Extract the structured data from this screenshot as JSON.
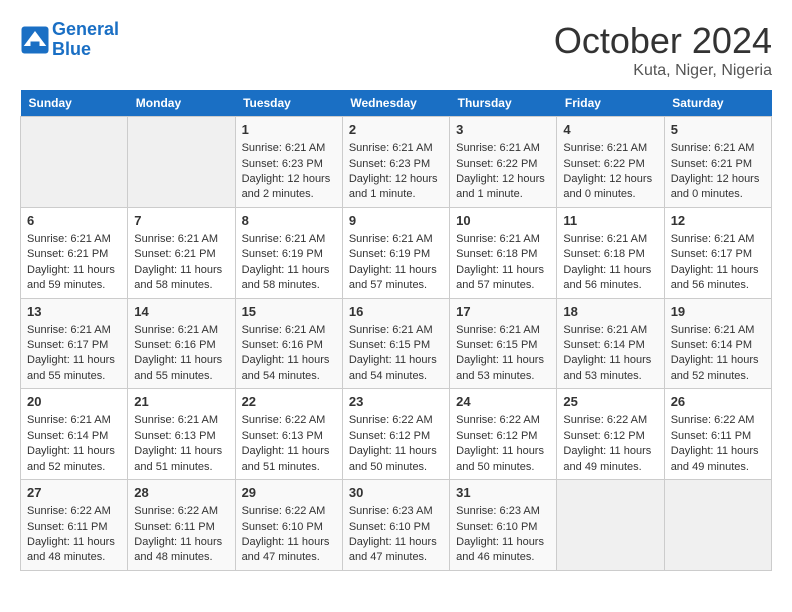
{
  "header": {
    "logo_line1": "General",
    "logo_line2": "Blue",
    "main_title": "October 2024",
    "subtitle": "Kuta, Niger, Nigeria"
  },
  "calendar": {
    "days_of_week": [
      "Sunday",
      "Monday",
      "Tuesday",
      "Wednesday",
      "Thursday",
      "Friday",
      "Saturday"
    ],
    "weeks": [
      [
        {
          "day": "",
          "empty": true
        },
        {
          "day": "",
          "empty": true
        },
        {
          "day": "1",
          "sunrise": "6:21 AM",
          "sunset": "6:23 PM",
          "daylight": "Daylight: 12 hours and 2 minutes."
        },
        {
          "day": "2",
          "sunrise": "6:21 AM",
          "sunset": "6:23 PM",
          "daylight": "Daylight: 12 hours and 1 minute."
        },
        {
          "day": "3",
          "sunrise": "6:21 AM",
          "sunset": "6:22 PM",
          "daylight": "Daylight: 12 hours and 1 minute."
        },
        {
          "day": "4",
          "sunrise": "6:21 AM",
          "sunset": "6:22 PM",
          "daylight": "Daylight: 12 hours and 0 minutes."
        },
        {
          "day": "5",
          "sunrise": "6:21 AM",
          "sunset": "6:21 PM",
          "daylight": "Daylight: 12 hours and 0 minutes."
        }
      ],
      [
        {
          "day": "6",
          "sunrise": "6:21 AM",
          "sunset": "6:21 PM",
          "daylight": "Daylight: 11 hours and 59 minutes."
        },
        {
          "day": "7",
          "sunrise": "6:21 AM",
          "sunset": "6:21 PM",
          "daylight": "Daylight: 11 hours and 58 minutes."
        },
        {
          "day": "8",
          "sunrise": "6:21 AM",
          "sunset": "6:19 PM",
          "daylight": "Daylight: 11 hours and 58 minutes."
        },
        {
          "day": "9",
          "sunrise": "6:21 AM",
          "sunset": "6:19 PM",
          "daylight": "Daylight: 11 hours and 57 minutes."
        },
        {
          "day": "10",
          "sunrise": "6:21 AM",
          "sunset": "6:18 PM",
          "daylight": "Daylight: 11 hours and 57 minutes."
        },
        {
          "day": "11",
          "sunrise": "6:21 AM",
          "sunset": "6:18 PM",
          "daylight": "Daylight: 11 hours and 56 minutes."
        },
        {
          "day": "12",
          "sunrise": "6:21 AM",
          "sunset": "6:17 PM",
          "daylight": "Daylight: 11 hours and 56 minutes."
        }
      ],
      [
        {
          "day": "13",
          "sunrise": "6:21 AM",
          "sunset": "6:17 PM",
          "daylight": "Daylight: 11 hours and 55 minutes."
        },
        {
          "day": "14",
          "sunrise": "6:21 AM",
          "sunset": "6:16 PM",
          "daylight": "Daylight: 11 hours and 55 minutes."
        },
        {
          "day": "15",
          "sunrise": "6:21 AM",
          "sunset": "6:16 PM",
          "daylight": "Daylight: 11 hours and 54 minutes."
        },
        {
          "day": "16",
          "sunrise": "6:21 AM",
          "sunset": "6:15 PM",
          "daylight": "Daylight: 11 hours and 54 minutes."
        },
        {
          "day": "17",
          "sunrise": "6:21 AM",
          "sunset": "6:15 PM",
          "daylight": "Daylight: 11 hours and 53 minutes."
        },
        {
          "day": "18",
          "sunrise": "6:21 AM",
          "sunset": "6:14 PM",
          "daylight": "Daylight: 11 hours and 53 minutes."
        },
        {
          "day": "19",
          "sunrise": "6:21 AM",
          "sunset": "6:14 PM",
          "daylight": "Daylight: 11 hours and 52 minutes."
        }
      ],
      [
        {
          "day": "20",
          "sunrise": "6:21 AM",
          "sunset": "6:14 PM",
          "daylight": "Daylight: 11 hours and 52 minutes."
        },
        {
          "day": "21",
          "sunrise": "6:21 AM",
          "sunset": "6:13 PM",
          "daylight": "Daylight: 11 hours and 51 minutes."
        },
        {
          "day": "22",
          "sunrise": "6:22 AM",
          "sunset": "6:13 PM",
          "daylight": "Daylight: 11 hours and 51 minutes."
        },
        {
          "day": "23",
          "sunrise": "6:22 AM",
          "sunset": "6:12 PM",
          "daylight": "Daylight: 11 hours and 50 minutes."
        },
        {
          "day": "24",
          "sunrise": "6:22 AM",
          "sunset": "6:12 PM",
          "daylight": "Daylight: 11 hours and 50 minutes."
        },
        {
          "day": "25",
          "sunrise": "6:22 AM",
          "sunset": "6:12 PM",
          "daylight": "Daylight: 11 hours and 49 minutes."
        },
        {
          "day": "26",
          "sunrise": "6:22 AM",
          "sunset": "6:11 PM",
          "daylight": "Daylight: 11 hours and 49 minutes."
        }
      ],
      [
        {
          "day": "27",
          "sunrise": "6:22 AM",
          "sunset": "6:11 PM",
          "daylight": "Daylight: 11 hours and 48 minutes."
        },
        {
          "day": "28",
          "sunrise": "6:22 AM",
          "sunset": "6:11 PM",
          "daylight": "Daylight: 11 hours and 48 minutes."
        },
        {
          "day": "29",
          "sunrise": "6:22 AM",
          "sunset": "6:10 PM",
          "daylight": "Daylight: 11 hours and 47 minutes."
        },
        {
          "day": "30",
          "sunrise": "6:23 AM",
          "sunset": "6:10 PM",
          "daylight": "Daylight: 11 hours and 47 minutes."
        },
        {
          "day": "31",
          "sunrise": "6:23 AM",
          "sunset": "6:10 PM",
          "daylight": "Daylight: 11 hours and 46 minutes."
        },
        {
          "day": "",
          "empty": true
        },
        {
          "day": "",
          "empty": true
        }
      ]
    ]
  }
}
